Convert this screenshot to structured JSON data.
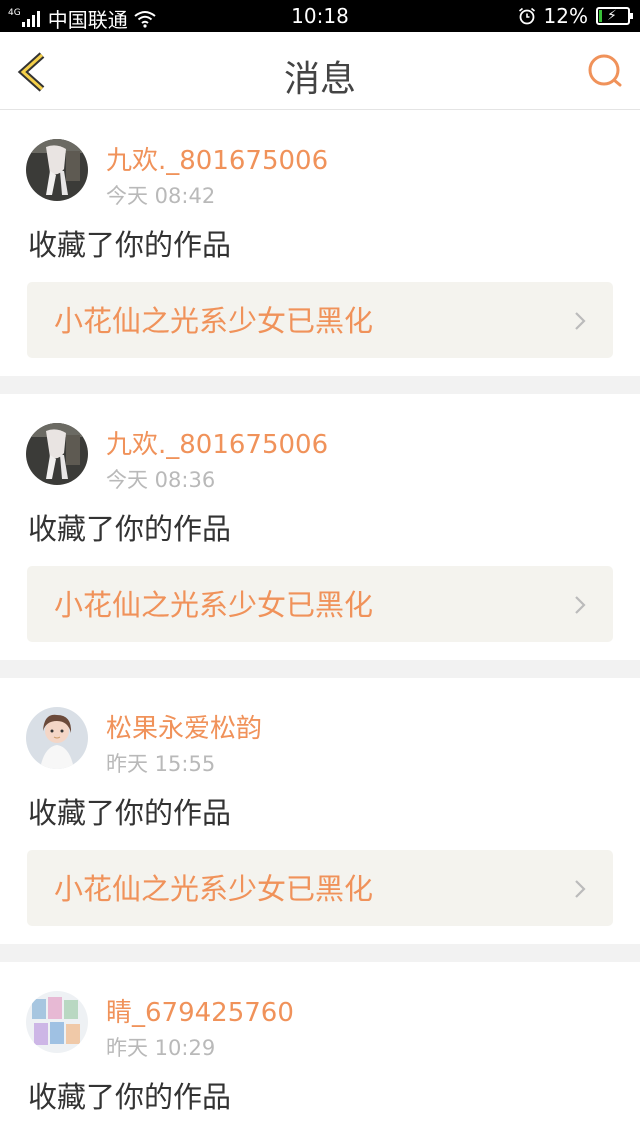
{
  "status_bar": {
    "network_type": "4G",
    "carrier": "中国联通",
    "time": "10:18",
    "battery_percent": "12%",
    "battery_level": 0.12,
    "battery_color": "#39c239"
  },
  "nav": {
    "back_icon": "chevron-left-icon",
    "title": "消息",
    "search_icon": "search-icon",
    "accent_color": "#f0925a"
  },
  "messages": [
    {
      "username": "九欢._801675006",
      "time": "今天 08:42",
      "action": "收藏了你的作品",
      "work_title": "小花仙之光系少女已黑化",
      "avatar": "avatar-photo-1"
    },
    {
      "username": "九欢._801675006",
      "time": "今天 08:36",
      "action": "收藏了你的作品",
      "work_title": "小花仙之光系少女已黑化",
      "avatar": "avatar-photo-1"
    },
    {
      "username": "松果永爱松韵",
      "time": "昨天 15:55",
      "action": "收藏了你的作品",
      "work_title": "小花仙之光系少女已黑化",
      "avatar": "avatar-photo-2"
    },
    {
      "username": "睛_679425760",
      "time": "昨天 10:29",
      "action": "收藏了你的作品",
      "avatar": "avatar-photo-3"
    }
  ]
}
